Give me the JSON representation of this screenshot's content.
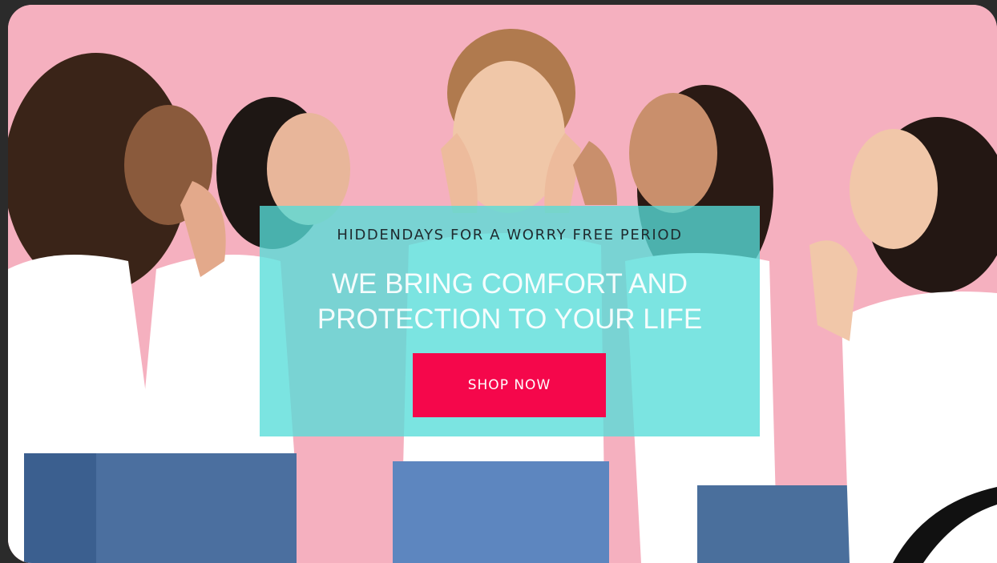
{
  "hero": {
    "kicker": "HIDDENDAYS FOR A WORRY FREE PERIOD",
    "headline_line1": "WE BRING COMFORT AND",
    "headline_line2": "PROTECTION TO YOUR LIFE",
    "cta_label": "SHOP NOW"
  },
  "colors": {
    "background": "#f5adbd",
    "overlay": "#56dcd8",
    "cta": "#f5074b",
    "frame": "#2b2b2b"
  }
}
